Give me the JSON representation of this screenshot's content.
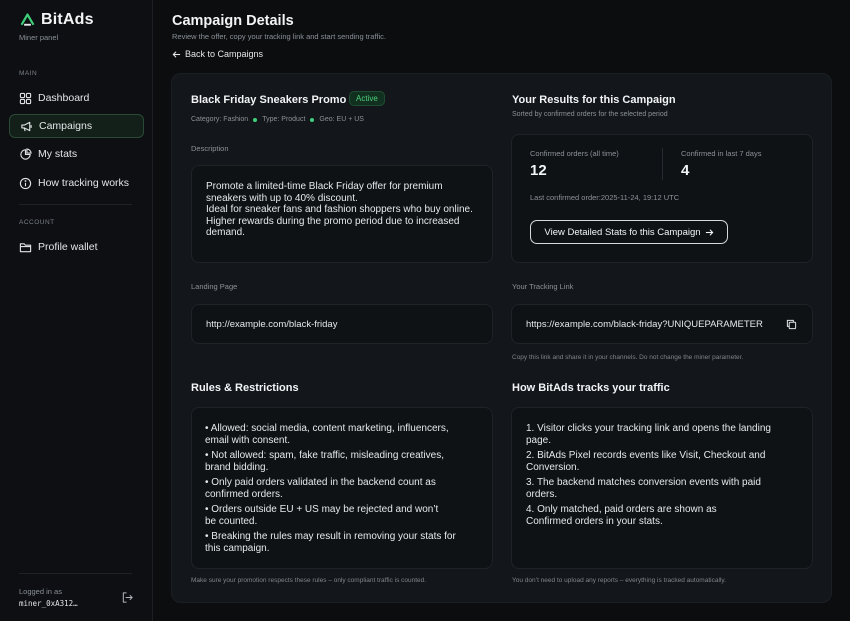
{
  "sidebar": {
    "brand_name": "BitAds",
    "brand_sub": "Miner panel",
    "section_main": "MAIN",
    "section_account": "ACCOUNT",
    "items": [
      {
        "label": "Dashboard",
        "icon": "dashboard-icon"
      },
      {
        "label": "Campaigns",
        "icon": "megaphone-icon",
        "active": true
      },
      {
        "label": "My stats",
        "icon": "pie-chart-icon"
      },
      {
        "label": "How tracking works",
        "icon": "info-icon"
      }
    ],
    "account_items": [
      {
        "label": "Profile wallet",
        "icon": "folder-icon"
      }
    ],
    "logged_in_label": "Logged in as",
    "logged_in_user": "miner_0xA312…"
  },
  "header": {
    "title": "Campaign Details",
    "subtitle": "Review the offer, copy your tracking link and start sending traffic.",
    "back_label": "Back to Campaigns"
  },
  "campaign": {
    "name": "Black Friday Sneakers Promo",
    "status": "Active",
    "category": "Category: Fashion",
    "type": "Type: Product",
    "geo": "Geo: EU + US",
    "description_label": "Description",
    "description": [
      "Promote a limited-time Black Friday offer for premium",
      "sneakers with up to 40% discount.",
      "Ideal for sneaker fans and fashion shoppers who buy online.",
      "Higher rewards during the promo period due to increased",
      "demand."
    ],
    "landing_label": "Landing Page",
    "landing_url": "http://example.com/black-friday"
  },
  "results": {
    "title": "Your Results for this Campaign",
    "subtitle": "Sorted by confirmed orders for the selected period",
    "confirmed_all_label": "Confirmed orders (all time)",
    "confirmed_all_value": "12",
    "confirmed_7d_label": "Confirmed in last 7 days",
    "confirmed_7d_value": "4",
    "last_confirmed": "Last confirmed order:2025-11-24, 19:12 UTC",
    "details_button": "View Detailed Stats fo this Campaign"
  },
  "tracking": {
    "label": "Your Tracking Link",
    "url": "https://example.com/black-friday?UNIQUEPARAMETER",
    "note": "Copy this link and share it in your channels. Do not change the miner parameter."
  },
  "rules": {
    "title": "Rules & Restrictions",
    "items": [
      [
        "• Allowed: social media, content marketing, influencers,",
        "email with consent."
      ],
      [
        "• Not allowed: spam, fake traffic, misleading creatives,",
        "brand bidding."
      ],
      [
        "• Only paid orders validated in the backend count as",
        "confirmed orders."
      ],
      [
        "• Orders outside EU + US may be rejected and won’t",
        "be counted."
      ],
      [
        "• Breaking the rules may result in removing your stats for",
        "this campaign."
      ]
    ],
    "note": "Make sure your promotion respects these rules – only compliant traffic is counted."
  },
  "how": {
    "title": "How BitAds tracks your traffic",
    "items": [
      [
        "1. Visitor clicks your tracking link and opens the landing",
        "page."
      ],
      [
        "2. BitAds Pixel records events like Visit, Checkout and",
        "Conversion."
      ],
      [
        "3. The backend matches conversion events with paid",
        "orders."
      ],
      [
        "4. Only matched, paid orders are shown as",
        "Confirmed orders in your stats."
      ]
    ],
    "note": "You don’t need to upload any reports – everything is tracked automatically."
  },
  "colors": {
    "accent_green": "#4ed07d",
    "background": "#0b0d0f",
    "card": "#13161a"
  }
}
